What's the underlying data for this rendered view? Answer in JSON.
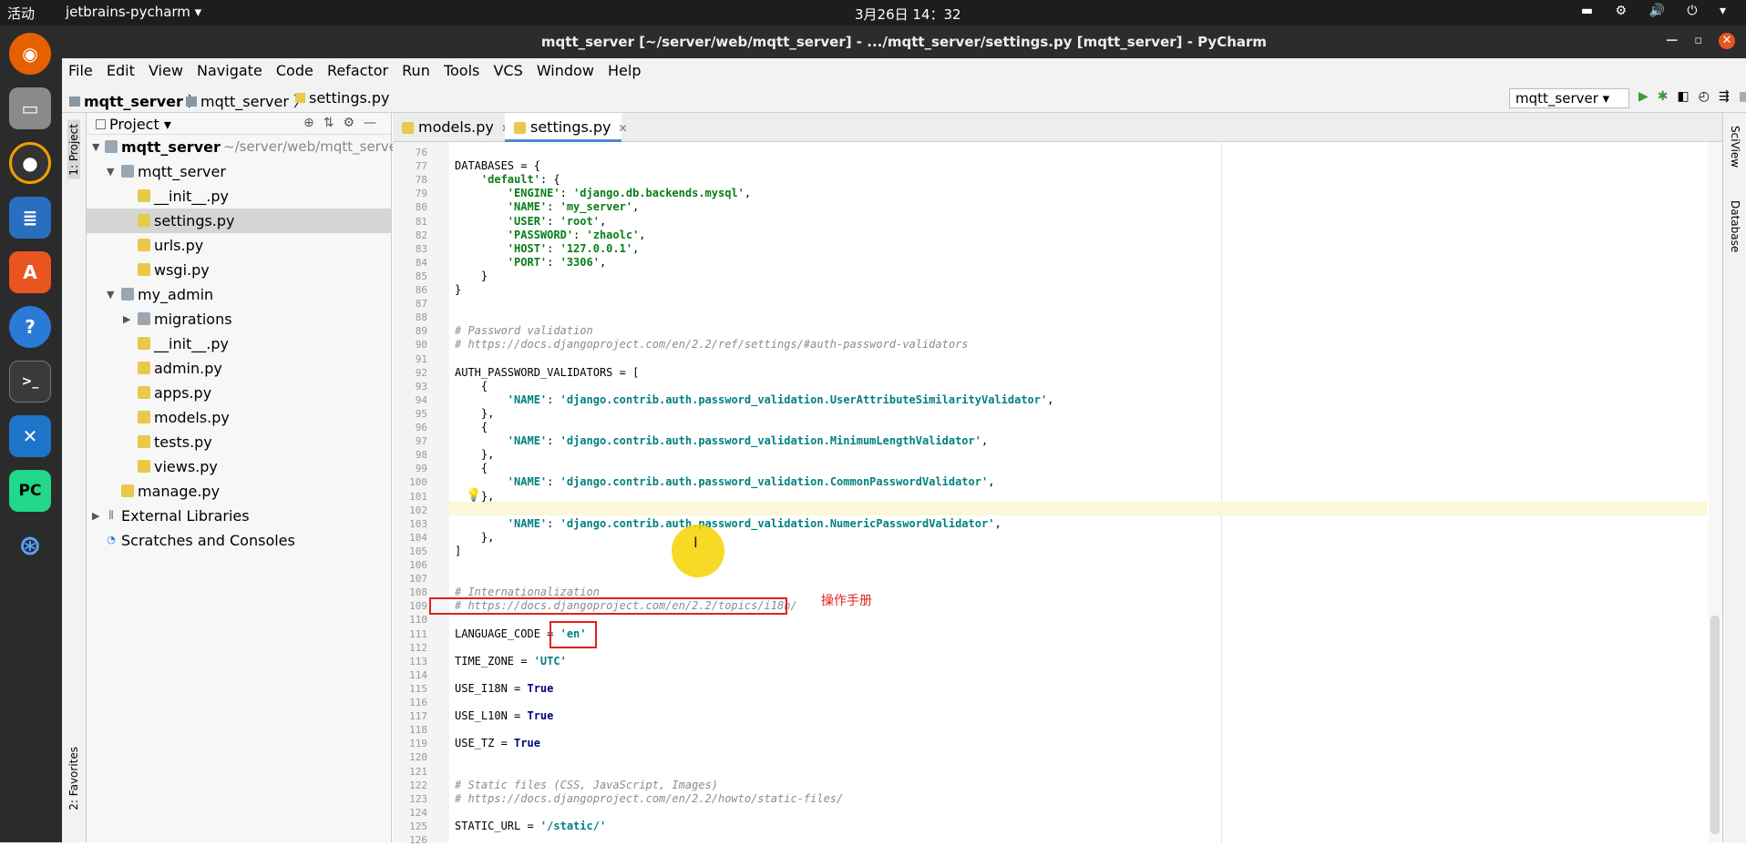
{
  "system_bar": {
    "activities": "活动",
    "app_menu": "jetbrains-pycharm ▾",
    "clock": "3月26日 14：32"
  },
  "window": {
    "title": "mqtt_server [~/server/web/mqtt_server] - .../mqtt_server/settings.py [mqtt_server] - PyCharm"
  },
  "menu": [
    "File",
    "Edit",
    "View",
    "Navigate",
    "Code",
    "Refactor",
    "Run",
    "Tools",
    "VCS",
    "Window",
    "Help"
  ],
  "breadcrumbs": [
    "mqtt_server",
    "mqtt_server",
    "settings.py"
  ],
  "run_config": "mqtt_server",
  "side_tabs": {
    "project": "1: Project",
    "favorites": "2: Favorites",
    "sciview": "SciView",
    "database": "Database"
  },
  "project_panel": {
    "title": "Project",
    "tree": [
      {
        "label": "mqtt_server",
        "path": "~/server/web/mqtt_server",
        "type": "folder",
        "bold": true
      },
      {
        "label": "mqtt_server",
        "type": "folder"
      },
      {
        "label": "__init__.py",
        "type": "py"
      },
      {
        "label": "settings.py",
        "type": "py",
        "selected": true
      },
      {
        "label": "urls.py",
        "type": "py"
      },
      {
        "label": "wsgi.py",
        "type": "py"
      },
      {
        "label": "my_admin",
        "type": "folder"
      },
      {
        "label": "migrations",
        "type": "folder"
      },
      {
        "label": "__init__.py",
        "type": "py"
      },
      {
        "label": "admin.py",
        "type": "py"
      },
      {
        "label": "apps.py",
        "type": "py"
      },
      {
        "label": "models.py",
        "type": "py"
      },
      {
        "label": "tests.py",
        "type": "py"
      },
      {
        "label": "views.py",
        "type": "py"
      },
      {
        "label": "manage.py",
        "type": "py"
      },
      {
        "label": "External Libraries",
        "type": "lib"
      },
      {
        "label": "Scratches and Consoles",
        "type": "scratch"
      }
    ]
  },
  "editor_tabs": [
    {
      "label": "models.py",
      "active": false
    },
    {
      "label": "settings.py",
      "active": true
    }
  ],
  "code_lines": [
    {
      "n": "76",
      "html": ""
    },
    {
      "n": "77",
      "html": "DATABASES = {"
    },
    {
      "n": "78",
      "html": "    <span class='s'>'default'</span>: {"
    },
    {
      "n": "79",
      "html": "        <span class='s'>'ENGINE'</span>: <span class='s'>'django.db.backends.mysql'</span>,"
    },
    {
      "n": "80",
      "html": "        <span class='s'>'NAME'</span>: <span class='s'>'my_server'</span>,"
    },
    {
      "n": "81",
      "html": "        <span class='s'>'USER'</span>: <span class='s'>'root'</span>,"
    },
    {
      "n": "82",
      "html": "        <span class='s'>'PASSWORD'</span>: <span class='s'>'zhaolc'</span>,"
    },
    {
      "n": "83",
      "html": "        <span class='s'>'HOST'</span>: <span class='s'>'127.0.0.1'</span>,"
    },
    {
      "n": "84",
      "html": "        <span class='s'>'PORT'</span>: <span class='s'>'3306'</span>,"
    },
    {
      "n": "85",
      "html": "    }"
    },
    {
      "n": "86",
      "html": "}"
    },
    {
      "n": "87",
      "html": ""
    },
    {
      "n": "88",
      "html": ""
    },
    {
      "n": "89",
      "html": "<span class='cm'># Password validation</span>"
    },
    {
      "n": "90",
      "html": "<span class='cm'># https://docs.djangoproject.com/en/2.2/ref/settings/#auth-password-validators</span>"
    },
    {
      "n": "91",
      "html": ""
    },
    {
      "n": "92",
      "html": "AUTH_PASSWORD_VALIDATORS = ["
    },
    {
      "n": "93",
      "html": "    {"
    },
    {
      "n": "94",
      "html": "        <span class='s2'>'NAME'</span>: <span class='s2'>'django.contrib.auth.password_validation.UserAttributeSimilarityValidator'</span>,"
    },
    {
      "n": "95",
      "html": "    },"
    },
    {
      "n": "96",
      "html": "    {"
    },
    {
      "n": "97",
      "html": "        <span class='s2'>'NAME'</span>: <span class='s2'>'django.contrib.auth.password_validation.MinimumLengthValidator'</span>,"
    },
    {
      "n": "98",
      "html": "    },"
    },
    {
      "n": "99",
      "html": "    {"
    },
    {
      "n": "100",
      "html": "        <span class='s2'>'NAME'</span>: <span class='s2'>'django.contrib.auth.password_validation.CommonPasswordValidator'</span>,"
    },
    {
      "n": "101",
      "html": "    },"
    },
    {
      "n": "102",
      "html": "    {"
    },
    {
      "n": "103",
      "html": "        <span class='s2'>'NAME'</span>: <span class='s2'>'django.contrib.auth.password_validation.NumericPasswordValidator'</span>,"
    },
    {
      "n": "104",
      "html": "    },"
    },
    {
      "n": "105",
      "html": "]"
    },
    {
      "n": "106",
      "html": ""
    },
    {
      "n": "107",
      "html": ""
    },
    {
      "n": "108",
      "html": "<span class='cm'># Internationalization</span>"
    },
    {
      "n": "109",
      "html": "<span class='cm'># https://docs.djangoproject.com/en/2.2/topics/i18n/</span>"
    },
    {
      "n": "110",
      "html": ""
    },
    {
      "n": "111",
      "html": "LANGUAGE_CODE = <span class='s2'>'en'</span>"
    },
    {
      "n": "112",
      "html": ""
    },
    {
      "n": "113",
      "html": "TIME_ZONE = <span class='s2'>'UTC'</span>"
    },
    {
      "n": "114",
      "html": ""
    },
    {
      "n": "115",
      "html": "USE_I18N = <span class='kw'>True</span>"
    },
    {
      "n": "116",
      "html": ""
    },
    {
      "n": "117",
      "html": "USE_L10N = <span class='kw'>True</span>"
    },
    {
      "n": "118",
      "html": ""
    },
    {
      "n": "119",
      "html": "USE_TZ = <span class='kw'>True</span>"
    },
    {
      "n": "120",
      "html": ""
    },
    {
      "n": "121",
      "html": ""
    },
    {
      "n": "122",
      "html": "<span class='cm'># Static files (CSS, JavaScript, Images)</span>"
    },
    {
      "n": "123",
      "html": "<span class='cm'># https://docs.djangoproject.com/en/2.2/howto/static-files/</span>"
    },
    {
      "n": "124",
      "html": ""
    },
    {
      "n": "125",
      "html": "STATIC_URL = <span class='s2'>'/static/'</span>"
    },
    {
      "n": "126",
      "html": ""
    }
  ],
  "annotation_text": "操作手册",
  "colors": {
    "accent": "#4a8cd6",
    "annotation": "#e02020",
    "cursor_highlight": "#f5d400"
  }
}
